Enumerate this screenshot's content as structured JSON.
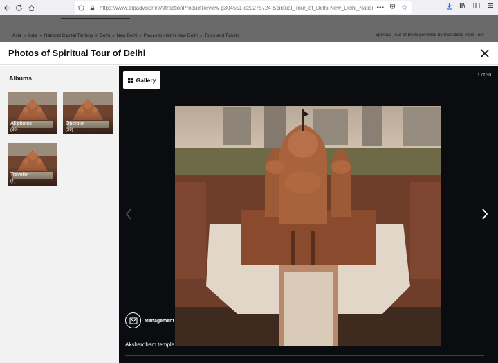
{
  "browser": {
    "url": "https://www.tripadvisor.in/AttractionProductReview-g304551-d20275724-Spiritual_Tour_of_Delhi-New_Delhi_National_Ca..."
  },
  "page": {
    "breadcrumbs": [
      "Asia",
      "»",
      "India",
      "»",
      "National Capital Territory of Delhi",
      "»",
      "New Delhi",
      "»",
      "Places to visit in New Delhi",
      "»",
      "Tours and Tickets"
    ],
    "provider_text": "Spiritual Tour of Delhi provided by Incredible India Tour"
  },
  "modal": {
    "title": "Photos of Spiritual Tour of Delhi",
    "albums_heading": "Albums",
    "albums": [
      {
        "name": "All photos",
        "count": "(30)"
      },
      {
        "name": "Operator",
        "count": "(29)"
      },
      {
        "name": "Traveller",
        "count": "(1)"
      }
    ],
    "viewer": {
      "gallery_label": "Gallery",
      "counter": "1 of 30",
      "owner_label": "Management",
      "caption": "Akshardham temple"
    }
  },
  "colors": {
    "viewer_bg": "#0a0c10",
    "sidebar_bg": "#f2f2f2",
    "link_accent": "#2a7ae2"
  }
}
